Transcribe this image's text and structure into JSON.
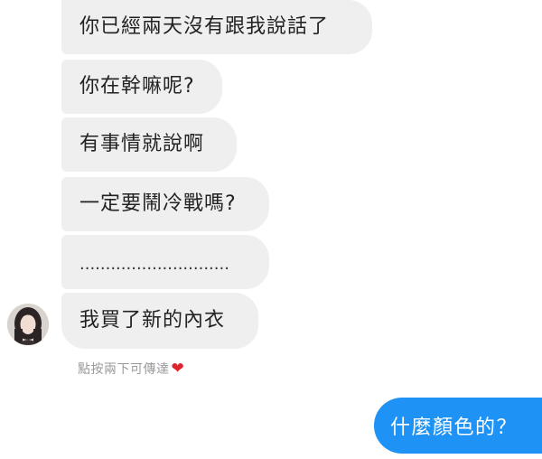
{
  "conversation": {
    "incoming_messages": [
      "你已經兩天沒有跟我說話了",
      "你在幹嘛呢?",
      "有事情就說啊",
      "一定要鬧冷戰嗎?",
      ".............................",
      "我買了新的內衣"
    ],
    "double_tap_hint": "點按兩下可傳達",
    "heart_icon": "red-heart-icon",
    "outgoing_message": "什麼顏色的？"
  },
  "colors": {
    "incoming_bubble": "#efefef",
    "outgoing_bubble": "#1f93f5",
    "hint_text": "#9a9a9a",
    "heart": "#e0242f"
  }
}
